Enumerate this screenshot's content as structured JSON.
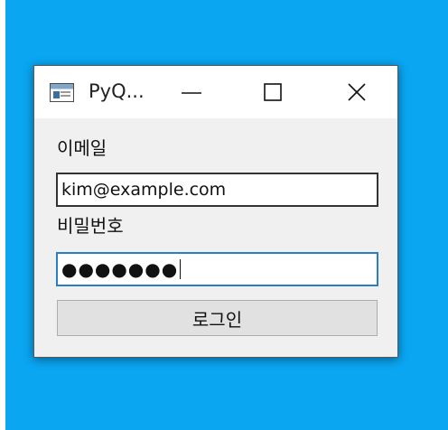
{
  "window": {
    "title": "PyQ...",
    "controls": {
      "minimize_icon": "minimize-icon",
      "maximize_icon": "maximize-icon",
      "close_icon": "close-icon"
    }
  },
  "form": {
    "email_label": "이메일",
    "email_value": "kim@example.com",
    "password_label": "비밀번호",
    "password_value_masked": "●●●●●●●",
    "login_button_label": "로그인"
  },
  "colors": {
    "desktop": "#0aa6f2",
    "window_bg": "#f0f0f0",
    "focus_border": "#2a7fc4"
  }
}
